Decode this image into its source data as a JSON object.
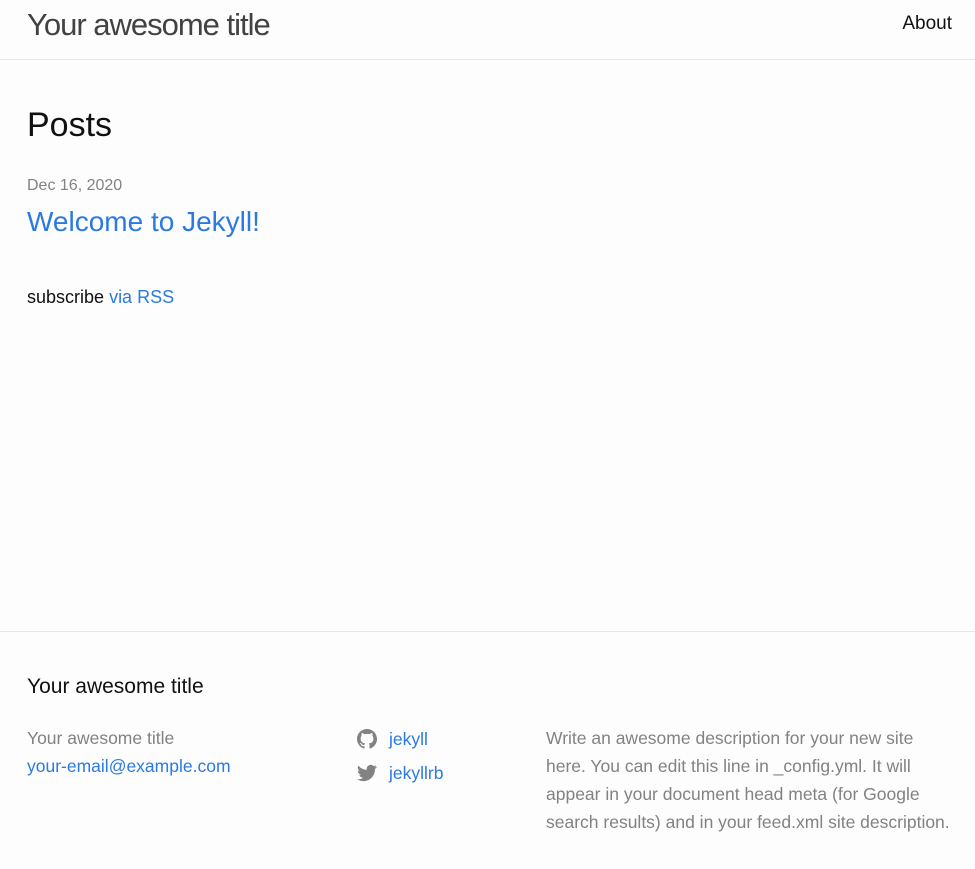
{
  "header": {
    "site_title": "Your awesome title",
    "nav": {
      "about": "About"
    }
  },
  "main": {
    "heading": "Posts",
    "posts": [
      {
        "date": "Dec 16, 2020",
        "title": "Welcome to Jekyll!"
      }
    ],
    "rss": {
      "prefix": "subscribe",
      "link": "via RSS"
    }
  },
  "footer": {
    "heading": "Your awesome title",
    "name": "Your awesome title",
    "email": "your-email@example.com",
    "social": [
      {
        "icon": "github-icon",
        "username": "jekyll"
      },
      {
        "icon": "twitter-icon",
        "username": "jekyllrb"
      }
    ],
    "description": "Write an awesome description for your new site here. You can edit this line in _config.yml. It will appear in your document head meta (for Google search results) and in your feed.xml site description."
  },
  "colors": {
    "link": "#2a7ae2",
    "muted": "#828282",
    "text": "#111111",
    "background": "#fdfdfd",
    "border": "#e8e8e8"
  }
}
